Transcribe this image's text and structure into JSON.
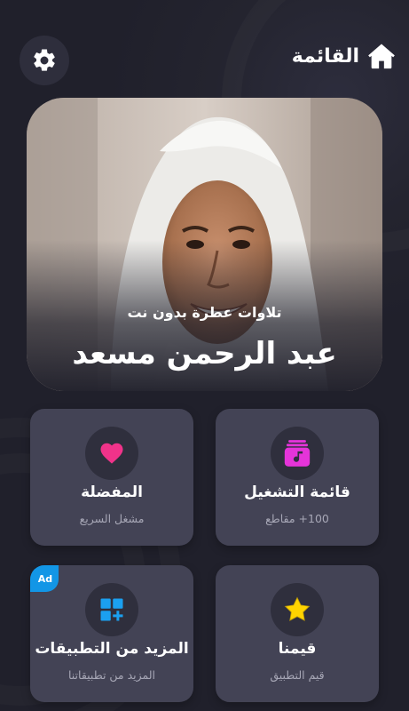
{
  "header": {
    "title": "القائمة",
    "home_icon": "home-icon",
    "settings_icon": "gear-icon"
  },
  "hero": {
    "subtitle": "تلاوات عطرة بدون نت",
    "title": "عبد الرحمن مسعد"
  },
  "cards": {
    "playlist": {
      "title": "قائمة التشغيل",
      "subtitle": "100+ مقاطع",
      "icon": "music-playlist-icon",
      "icon_color": "#e534d9"
    },
    "favorites": {
      "title": "المفضلة",
      "subtitle": "مشغل السريع",
      "icon": "heart-icon",
      "icon_color": "#f0338a"
    },
    "rate": {
      "title": "قيمنا",
      "subtitle": "قيم التطبيق",
      "icon": "star-icon",
      "icon_color": "#ffd400"
    },
    "more_apps": {
      "title": "المزيد من التطبيقات",
      "subtitle": "المزيد من تطبيقاتنا",
      "icon": "apps-grid-plus-icon",
      "icon_color": "#1ba0f0",
      "badge": "Ad"
    }
  },
  "colors": {
    "background": "#22222f",
    "card": "#434355",
    "icon_circle": "#2f2f3d",
    "ad_badge": "#1296e6"
  }
}
